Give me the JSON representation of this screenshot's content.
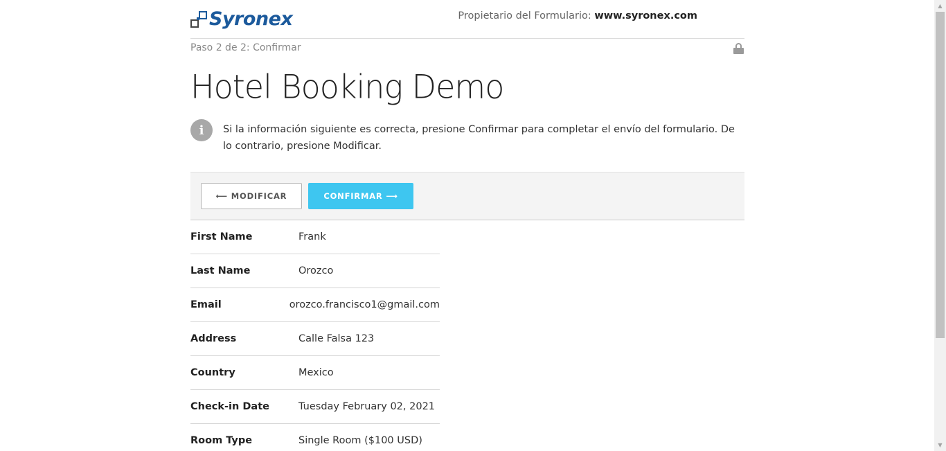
{
  "header": {
    "logo_text": "Syronex",
    "owner_label": "Propietario del Formulario:",
    "owner_site": "www.syronex.com"
  },
  "step": "Paso 2 de 2: Confirmar",
  "title": "Hotel Booking Demo",
  "notice": "Si la información siguiente es correcta, presione Confirmar para completar el envío del formulario. De lo contrario, presione Modificar.",
  "actions": {
    "modify_label": "⟵ MODIFICAR",
    "confirm_label": "CONFIRMAR ⟶"
  },
  "fields": [
    {
      "label": "First Name",
      "value": "Frank"
    },
    {
      "label": "Last Name",
      "value": "Orozco"
    },
    {
      "label": "Email",
      "value": "orozco.francisco1@gmail.com"
    },
    {
      "label": "Address",
      "value": "Calle Falsa 123"
    },
    {
      "label": "Country",
      "value": "Mexico"
    },
    {
      "label": "Check-in Date",
      "value": "Tuesday February 02, 2021"
    },
    {
      "label": "Room Type",
      "value": "Single Room ($100 USD)"
    }
  ],
  "colors": {
    "brand": "#1c5a9c",
    "confirm": "#3ec6f0"
  },
  "icons": {
    "info": "info-icon",
    "lock": "lock-icon"
  }
}
